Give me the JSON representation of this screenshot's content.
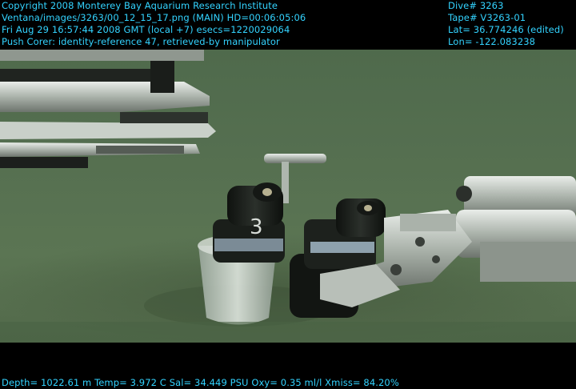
{
  "overlay": {
    "left_lines": [
      "Copyright 2008 Monterey Bay Aquarium Research Institute",
      "Ventana/images/3263/00_12_15_17.png (MAIN)  HD=00:06:05:06",
      "Fri Aug 29 16:57:44 2008 GMT (local +7)  esecs=1220029064",
      "Push Corer: identity-reference 47, retrieved-by manipulator"
    ],
    "right_lines": [
      "Dive# 3263",
      "Tape# V3263-01",
      "Lat= 36.774246 (edited)",
      "Lon= -122.083238"
    ],
    "bottom_line": "Depth= 1022.61 m  Temp= 3.972 C  Sal= 34.449 PSU  Oxy= 0.35 ml/l  Xmiss= 84.20%",
    "color": "#33d3ff"
  },
  "scene": {
    "core_label": "3"
  }
}
